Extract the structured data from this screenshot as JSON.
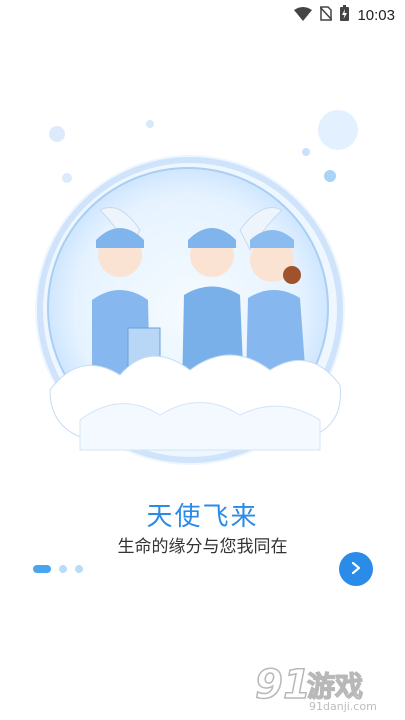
{
  "status_bar": {
    "time": "10:03",
    "icons": [
      "wifi-icon",
      "no-sim-icon",
      "battery-charging-icon"
    ]
  },
  "onboarding": {
    "title": "天使飞来",
    "subtitle": "生命的缘分与您我同在",
    "page_count": 3,
    "current_page": 1,
    "next_icon": "chevron-right-icon",
    "accent_color": "#2a8be8"
  },
  "watermark": {
    "logo_text": "91游戏",
    "url": "91danji.com"
  }
}
